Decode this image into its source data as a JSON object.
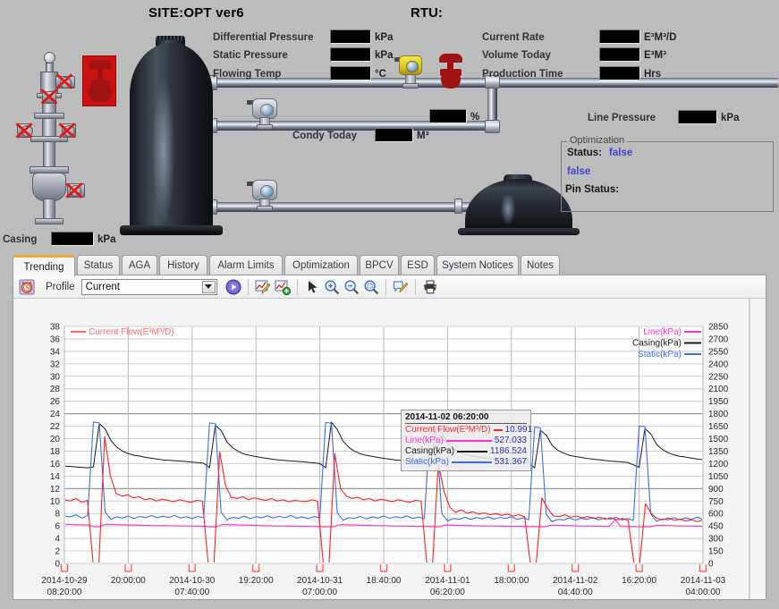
{
  "hmi": {
    "site_title": "SITE:OPT ver6",
    "rtu_title": "RTU:",
    "left_readouts": [
      {
        "label": "Differential Pressure",
        "value": "",
        "unit": "kPa"
      },
      {
        "label": "Static Pressure",
        "value": "",
        "unit": "kPa"
      },
      {
        "label": "Flowing Temp",
        "value": "",
        "unit": "°C"
      }
    ],
    "right_readouts": [
      {
        "label": "Current Rate",
        "value": "",
        "unit": "E³M³/D"
      },
      {
        "label": "Volume Today",
        "value": "",
        "unit": "E³M³"
      },
      {
        "label": "Production Time",
        "value": "",
        "unit": "Hrs"
      }
    ],
    "condy": {
      "label": "Condy Today",
      "value": "",
      "unit": "M³"
    },
    "percent": {
      "label": "",
      "value": "",
      "unit": "%"
    },
    "line_pressure": {
      "label": "Line Pressure",
      "value": "",
      "unit": "kPa"
    },
    "casing": {
      "label": "Casing",
      "value": "",
      "unit": "kPa"
    },
    "optimization": {
      "title": "Optimization",
      "status_label": "Status:",
      "status_value": "false",
      "secondary_value": "false",
      "pin_status_label": "Pin Status:",
      "pin_status_value": ""
    }
  },
  "tabs": [
    {
      "label": "Trending",
      "active": true
    },
    {
      "label": "Status",
      "active": false
    },
    {
      "label": "AGA",
      "active": false
    },
    {
      "label": "History",
      "active": false
    },
    {
      "label": "Alarm Limits",
      "active": false
    },
    {
      "label": "Optimization",
      "active": false
    },
    {
      "label": "BPCV",
      "active": false
    },
    {
      "label": "ESD",
      "active": false
    },
    {
      "label": "System Notices",
      "active": false
    },
    {
      "label": "Notes",
      "active": false
    }
  ],
  "toolbar": {
    "alarm_icon": "alarm-clock-icon",
    "profile_label": "Profile",
    "profile_value": "Current",
    "profile_options": [
      "Current"
    ],
    "play_icon": "play-icon",
    "edit_chart_icon": "edit-chart-icon",
    "add_chart_icon": "add-chart-icon",
    "pointer_icon": "pointer-icon",
    "zoom_in_icon": "zoom-in-icon",
    "zoom_out_icon": "zoom-out-icon",
    "zoom_region_icon": "zoom-region-icon",
    "annotate_icon": "annotate-icon",
    "print_icon": "print-icon"
  },
  "tooltip": {
    "timestamp": "2014-11-02 06:20:00",
    "rows": [
      {
        "name": "Current Flow(E³M³/D)",
        "value": "10.991",
        "color": "#ff2a2a"
      },
      {
        "name": "Line(kPa)",
        "value": "527.033",
        "color": "#ff33cc"
      },
      {
        "name": "Casing(kPa)",
        "value": "1186.524",
        "color": "#1a1a1a"
      },
      {
        "name": "Static(kPa)",
        "value": "531.367",
        "color": "#3c6ef0"
      }
    ]
  },
  "chart_data": {
    "type": "line",
    "title": "",
    "xlabel": "",
    "ylabel": "",
    "grid": true,
    "legend_position": "top-left and right",
    "left_axis": {
      "label": "Current Flow(E³M³/D)",
      "ylim": [
        0,
        38
      ],
      "ticks": [
        0,
        2,
        4,
        6,
        8,
        10,
        12,
        14,
        16,
        18,
        20,
        22,
        24,
        26,
        28,
        30,
        32,
        34,
        36,
        38
      ]
    },
    "right_axis": {
      "label": "kPa",
      "ylim": [
        0,
        2850
      ],
      "ticks": [
        0,
        150,
        300,
        450,
        600,
        750,
        900,
        1050,
        1200,
        1350,
        1500,
        1650,
        1800,
        1950,
        2100,
        2250,
        2400,
        2550,
        2700,
        2850
      ]
    },
    "x_ticks": [
      "2014-10-29\n08:20:00",
      "20:00:00",
      "2014-10-30\n07:40:00",
      "19:20:00",
      "2014-10-31\n07:00:00",
      "18:40:00",
      "2014-11-01\n06:20:00",
      "18:00:00",
      "2014-11-02\n04:40:00",
      "16:20:00",
      "2014-11-03\n04:00:00"
    ],
    "legend_top": [
      {
        "name": "Current Flow(E³M³/D)",
        "color": "#ff6666"
      }
    ],
    "legend_right": [
      {
        "name": "Line(kPa)",
        "color": "#ff33cc"
      },
      {
        "name": "Casing(kPa)",
        "color": "#1a1a1a"
      },
      {
        "name": "Static(kPa)",
        "color": "#3c6ef0"
      }
    ],
    "series": [
      {
        "name": "Current Flow(E³M³/D)",
        "axis": "left",
        "unit": "E³M³/D",
        "color": "#ff2020",
        "description": "Sawtooth cycles: baseline ~10 with fine noise, sharp spike up to ~18-20 then drop to 0 at each cycle boundary (approx every 22h).",
        "values": [
          10.2,
          10.0,
          10.4,
          9.8,
          10.1,
          0.0,
          0.0,
          20.3,
          14.0,
          11.2,
          10.8,
          11.0,
          10.5,
          10.7,
          10.2,
          10.4,
          10.0,
          10.3,
          10.1,
          9.9,
          10.2,
          10.0,
          9.8,
          10.1,
          10.0,
          0.0,
          0.0,
          17.9,
          12.5,
          10.6,
          10.4,
          10.7,
          10.2,
          10.5,
          10.3,
          10.1,
          10.4,
          10.0,
          10.2,
          9.9,
          10.1,
          10.0,
          9.9,
          10.2,
          10.0,
          0.0,
          0.0,
          17.6,
          12.0,
          10.8,
          10.4,
          10.6,
          10.2,
          10.4,
          10.0,
          10.3,
          10.1,
          9.9,
          10.2,
          10.0,
          9.8,
          10.1,
          10.0,
          0.0,
          0.0,
          16.0,
          11.5,
          9.0,
          8.2,
          8.6,
          8.0,
          8.3,
          7.9,
          8.1,
          7.8,
          8.0,
          7.7,
          7.9,
          7.6,
          7.8,
          7.5,
          0.0,
          0.0,
          10.5,
          8.8,
          7.6,
          7.5,
          7.8,
          7.4,
          7.6,
          7.3,
          7.5,
          7.2,
          7.4,
          7.1,
          7.3,
          7.0,
          7.2,
          6.9,
          0.0,
          0.0,
          9.6,
          8.0,
          7.2,
          7.0,
          7.3,
          6.9,
          7.1,
          6.8,
          7.0,
          6.7,
          6.9
        ]
      },
      {
        "name": "Casing(kPa)",
        "axis": "right",
        "unit": "kPa",
        "color": "#1a1a1a",
        "description": "Decaying pressure between cycles: spikes to ~1650-1700 kPa at each cycle start then slowly declines to ~1150 kPa.",
        "values": [
          1170,
          1165,
          1160,
          1155,
          1150,
          1160,
          1680,
          1620,
          1480,
          1400,
          1350,
          1320,
          1300,
          1290,
          1275,
          1265,
          1255,
          1245,
          1240,
          1235,
          1230,
          1225,
          1218,
          1212,
          1205,
          1150,
          1660,
          1600,
          1460,
          1390,
          1345,
          1315,
          1298,
          1285,
          1272,
          1262,
          1252,
          1243,
          1238,
          1232,
          1228,
          1222,
          1215,
          1208,
          1200,
          1150,
          1700,
          1610,
          1470,
          1395,
          1348,
          1318,
          1300,
          1288,
          1274,
          1264,
          1254,
          1245,
          1240,
          1234,
          1229,
          1223,
          1216,
          1152,
          1640,
          1580,
          1450,
          1380,
          1340,
          1310,
          1295,
          1282,
          1270,
          1260,
          1250,
          1242,
          1236,
          1230,
          1226,
          1220,
          1210,
          1150,
          1600,
          1545,
          1420,
          1360,
          1325,
          1300,
          1285,
          1275,
          1263,
          1254,
          1246,
          1238,
          1232,
          1226,
          1220,
          1214,
          1186,
          1155,
          1620,
          1560,
          1430,
          1370,
          1330,
          1305,
          1288,
          1278,
          1266,
          1256,
          1248
        ]
      },
      {
        "name": "Static(kPa)",
        "axis": "right",
        "unit": "kPa",
        "color": "#3c6ef0",
        "description": "Noisy band around 450-600 kPa with very tall narrow spikes to ~1650 kPa at each cycle boundary.",
        "values": [
          570,
          560,
          585,
          545,
          575,
          1700,
          1690,
          620,
          530,
          560,
          545,
          570,
          540,
          565,
          550,
          575,
          548,
          568,
          552,
          578,
          545,
          562,
          540,
          566,
          550,
          1690,
          1680,
          615,
          525,
          555,
          542,
          568,
          538,
          562,
          548,
          572,
          546,
          566,
          550,
          576,
          544,
          560,
          538,
          564,
          548,
          1695,
          1685,
          610,
          520,
          550,
          540,
          565,
          535,
          560,
          545,
          570,
          542,
          562,
          548,
          572,
          540,
          558,
          536,
          1660,
          1650,
          600,
          510,
          540,
          530,
          555,
          528,
          552,
          536,
          560,
          532,
          554,
          540,
          562,
          530,
          548,
          526,
          1640,
          1630,
          590,
          500,
          530,
          522,
          546,
          520,
          544,
          528,
          552,
          524,
          546,
          531,
          554,
          522,
          540,
          518,
          1650,
          1645,
          595,
          505,
          535,
          525,
          550,
          524,
          548,
          530,
          556,
          526
        ]
      },
      {
        "name": "Line(kPa)",
        "axis": "right",
        "unit": "kPa",
        "color": "#ff33cc",
        "description": "Mostly hidden beneath the Static trace; visible as flat magenta floor segments around 440-470 kPa during the off portions of each cycle.",
        "values": [
          470,
          468,
          466,
          464,
          462,
          440,
          440,
          470,
          468,
          466,
          464,
          462,
          460,
          458,
          456,
          454,
          452,
          455,
          453,
          451,
          449,
          450,
          448,
          447,
          446,
          440,
          440,
          468,
          466,
          464,
          462,
          460,
          458,
          456,
          454,
          452,
          450,
          449,
          448,
          447,
          446,
          445,
          444,
          443,
          442,
          440,
          440,
          466,
          464,
          462,
          460,
          458,
          456,
          455,
          454,
          452,
          450,
          449,
          448,
          447,
          446,
          445,
          444,
          440,
          440,
          462,
          460,
          458,
          456,
          454,
          452,
          451,
          450,
          449,
          448,
          447,
          446,
          445,
          444,
          443,
          442,
          440,
          440,
          460,
          458,
          456,
          454,
          452,
          450,
          449,
          448,
          447,
          446,
          445,
          527,
          444,
          443,
          442,
          441,
          440,
          440,
          458,
          456,
          454,
          452,
          450,
          449,
          448,
          447,
          446
        ]
      }
    ]
  }
}
